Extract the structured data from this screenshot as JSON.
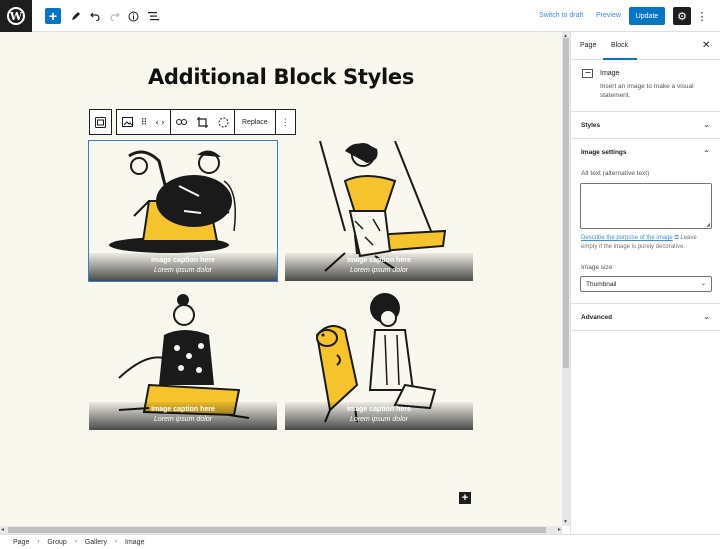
{
  "topbar": {
    "switch_to_draft": "Switch to draft",
    "preview": "Preview",
    "update": "Update"
  },
  "editor": {
    "title": "Additional Block Styles",
    "toolbar_replace": "Replace",
    "gallery": [
      {
        "caption_title": "Image caption here",
        "caption_sub": "Lorem ipsum dolor"
      },
      {
        "caption_title": "Image caption here",
        "caption_sub": "Lorem ipsum dolor"
      },
      {
        "caption_title": "Image caption here",
        "caption_sub": "Lorem ipsum dolor"
      },
      {
        "caption_title": "Image caption here",
        "caption_sub": "Lorem ipsum dolor"
      }
    ]
  },
  "sidebar": {
    "tabs": [
      "Page",
      "Block"
    ],
    "active_tab": "Block",
    "block_name": "Image",
    "block_description": "Insert an image to make a visual statement.",
    "panels": {
      "styles": "Styles",
      "image_settings": "Image settings",
      "advanced": "Advanced"
    },
    "alt_text_label": "Alt text (alternative text)",
    "alt_text_value": "",
    "help_link": "Describe the purpose of the image",
    "help_text": "Leave empty if the image is purely decorative.",
    "image_size_label": "Image size",
    "image_size_value": "Thumbnail"
  },
  "breadcrumb": [
    "Page",
    "Group",
    "Gallery",
    "Image"
  ],
  "colors": {
    "accent": "#0675c4",
    "canvas_bg": "#f9f8ef",
    "illustration_yellow": "#f5c32c"
  }
}
